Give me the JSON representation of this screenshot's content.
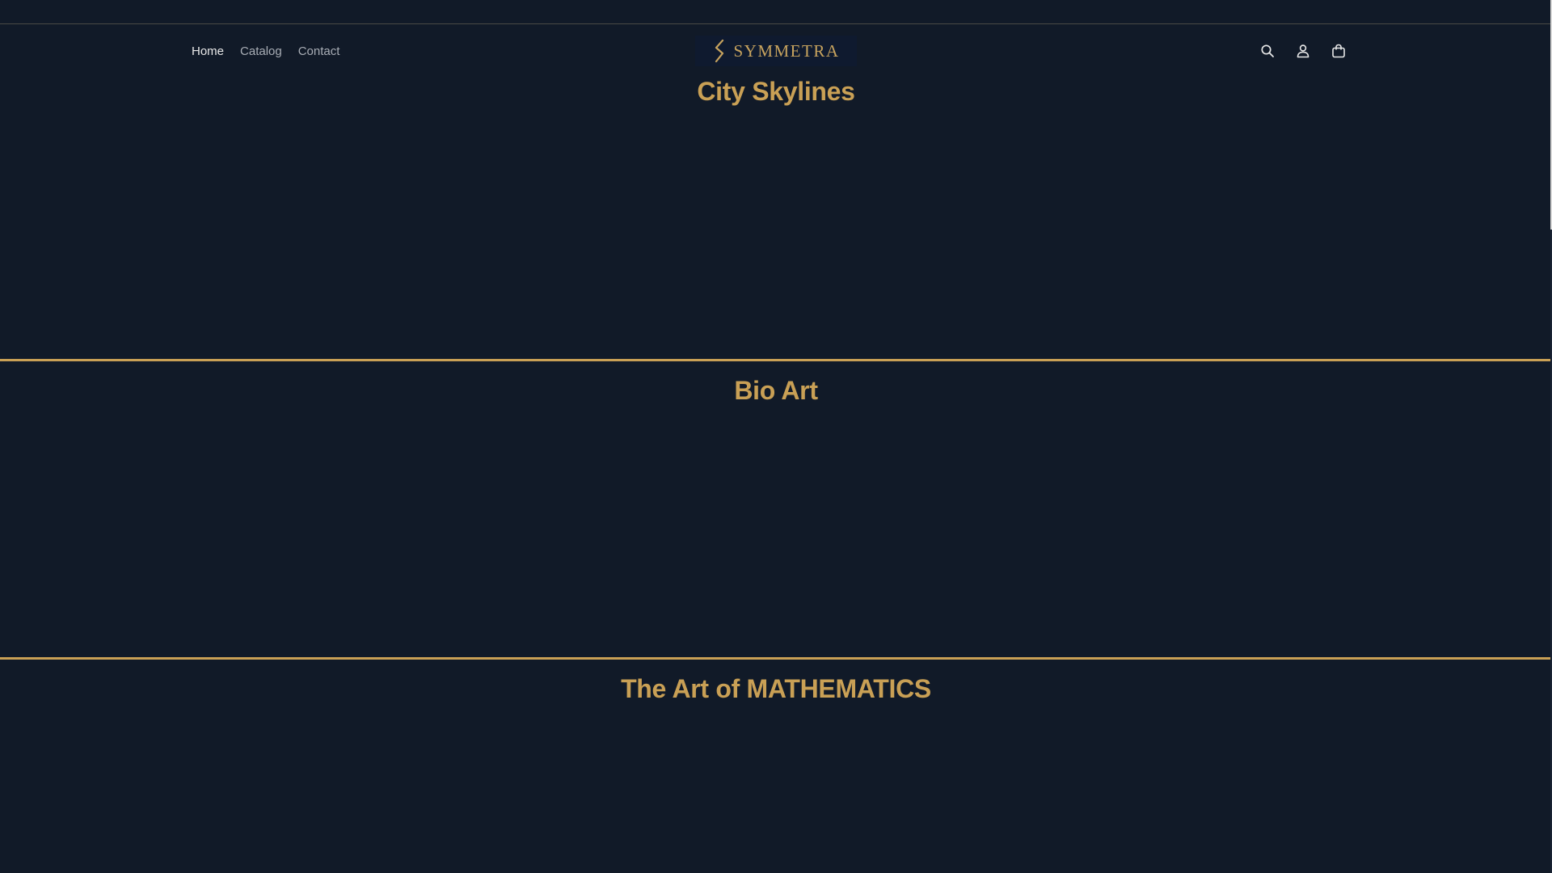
{
  "header": {
    "nav": [
      {
        "label": "Home",
        "active": true
      },
      {
        "label": "Catalog",
        "active": false
      },
      {
        "label": "Contact",
        "active": false
      }
    ],
    "logo_text": "SYMMETRA",
    "icons": [
      "search-icon",
      "account-icon",
      "cart-icon"
    ]
  },
  "sections": [
    {
      "title": "City Skylines"
    },
    {
      "title": "Bio Art"
    },
    {
      "title": "The Art of MATHEMATICS"
    }
  ],
  "colors": {
    "background": "#111a28",
    "accent": "#c9a055",
    "nav_text": "#a8adb5",
    "nav_active": "#e8e8e8"
  }
}
